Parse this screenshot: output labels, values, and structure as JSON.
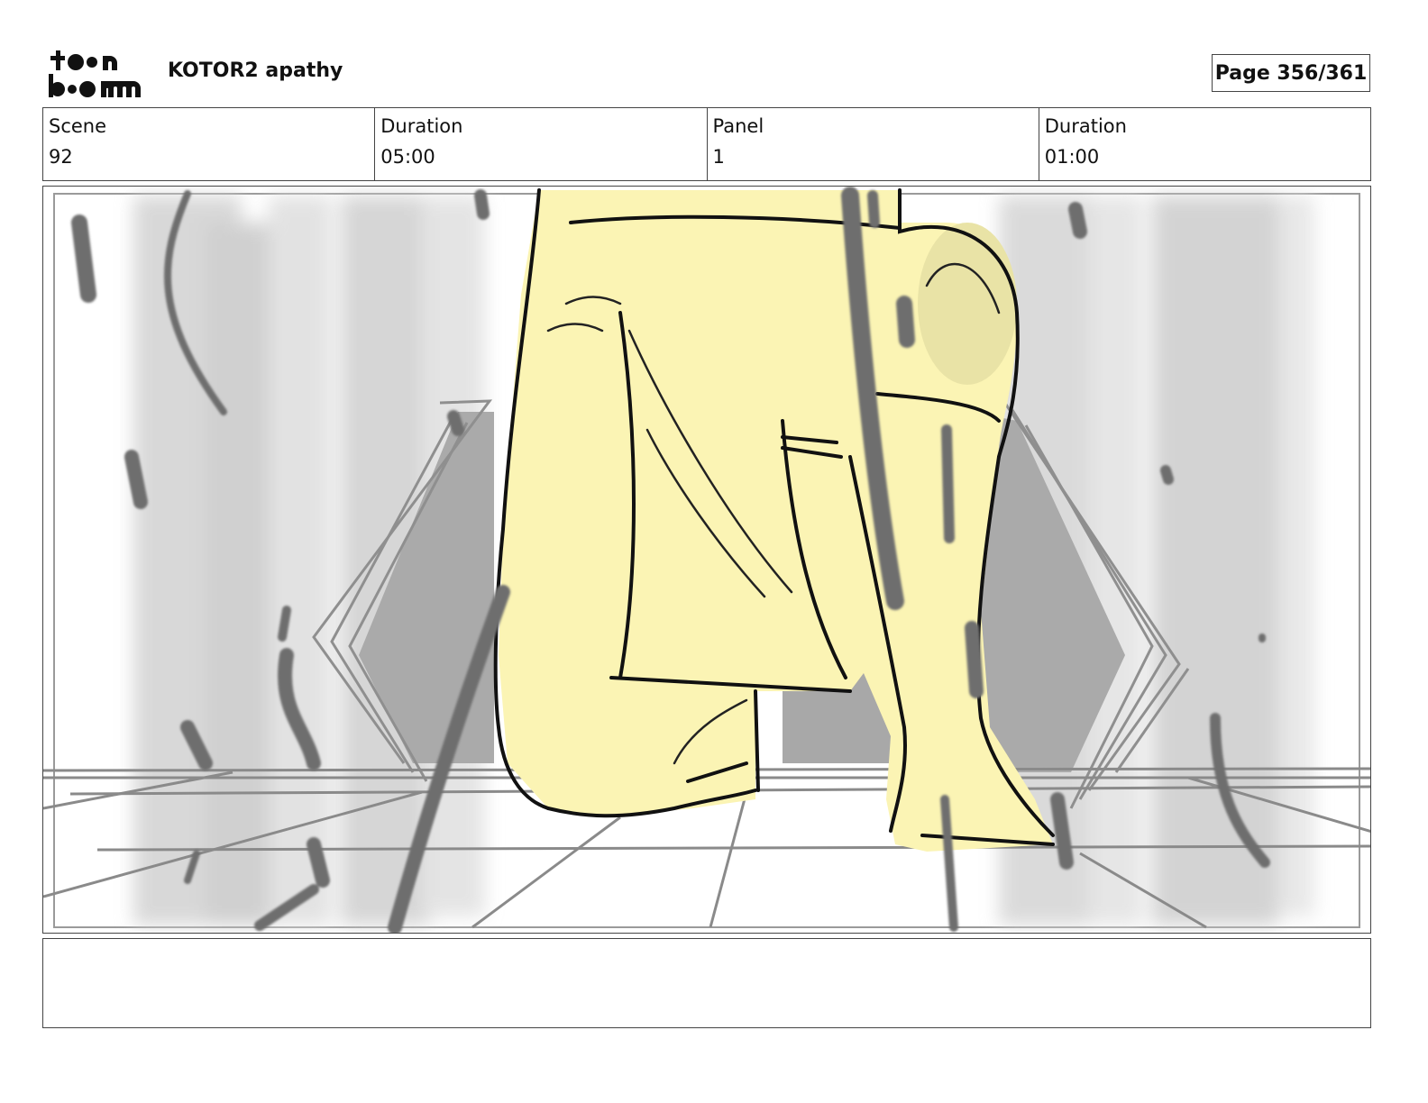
{
  "header": {
    "logo_text": "toonboom",
    "project_title": "KOTOR2 apathy",
    "page_label": "Page 356/361"
  },
  "info": {
    "scene_label": "Scene",
    "scene_value": "92",
    "scene_duration_label": "Duration",
    "scene_duration_value": "05:00",
    "panel_label": "Panel",
    "panel_value": "1",
    "panel_duration_label": "Duration",
    "panel_duration_value": "01:00"
  },
  "panel": {
    "description": "",
    "colors": {
      "figure_fill": "#fbf4b4",
      "wall_gray": "#d8d8d8",
      "dark_gray": "#8c8c8c"
    }
  },
  "notes": {
    "text": ""
  }
}
